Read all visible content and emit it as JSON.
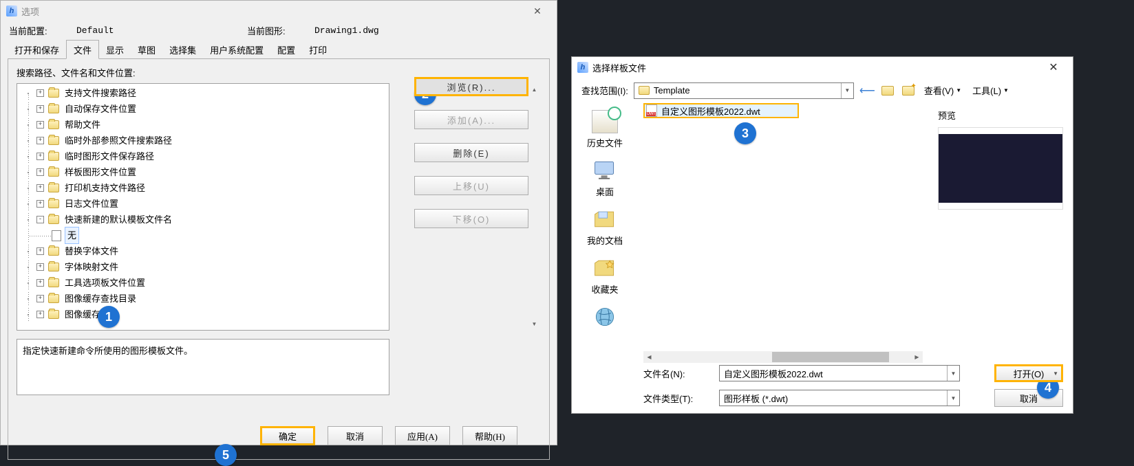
{
  "options_dialog": {
    "title": "选项",
    "info": {
      "current_config_label": "当前配置:",
      "current_config_value": "Default",
      "current_drawing_label": "当前图形:",
      "current_drawing_value": "Drawing1.dwg"
    },
    "tabs": [
      {
        "label": "打开和保存"
      },
      {
        "label": "文件",
        "active": true
      },
      {
        "label": "显示"
      },
      {
        "label": "草图"
      },
      {
        "label": "选择集"
      },
      {
        "label": "用户系统配置"
      },
      {
        "label": "配置"
      },
      {
        "label": "打印"
      }
    ],
    "group_label": "搜索路径、文件名和文件位置:",
    "tree": [
      {
        "kind": "folder",
        "exp": "+",
        "label": "支持文件搜索路径"
      },
      {
        "kind": "folder",
        "exp": "+",
        "label": "自动保存文件位置"
      },
      {
        "kind": "folder",
        "exp": "+",
        "label": "帮助文件"
      },
      {
        "kind": "folder",
        "exp": "+",
        "label": "临时外部参照文件搜索路径"
      },
      {
        "kind": "folder",
        "exp": "+",
        "label": "临时图形文件保存路径"
      },
      {
        "kind": "folder",
        "exp": "+",
        "label": "样板图形文件位置"
      },
      {
        "kind": "folder",
        "exp": "+",
        "label": "打印机支持文件路径"
      },
      {
        "kind": "folder",
        "exp": "+",
        "label": "日志文件位置"
      },
      {
        "kind": "folder",
        "exp": "-",
        "label": "快速新建的默认模板文件名",
        "children": [
          {
            "kind": "file",
            "label": "无",
            "selected": true
          }
        ]
      },
      {
        "kind": "folder",
        "exp": "+",
        "label": "替换字体文件"
      },
      {
        "kind": "folder",
        "exp": "+",
        "label": "字体映射文件"
      },
      {
        "kind": "folder",
        "exp": "+",
        "label": "工具选项板文件位置"
      },
      {
        "kind": "folder",
        "exp": "+",
        "label": "图像缓存查找目录"
      },
      {
        "kind": "folder",
        "exp": "+",
        "label": "图像缓存目录"
      }
    ],
    "side_buttons": {
      "browse": "浏览(R)...",
      "add": "添加(A)...",
      "delete": "删除(E)",
      "move_up": "上移(U)",
      "move_down": "下移(O)"
    },
    "description": "指定快速新建命令所使用的图形模板文件。",
    "bottom": {
      "ok": "确定",
      "cancel": "取消",
      "apply": "应用(A)",
      "help": "帮助(H)"
    }
  },
  "file_dialog": {
    "title": "选择样板文件",
    "look_in_label": "查找范围(I):",
    "look_in_value": "Template",
    "view_btn": "查看(V)",
    "tools_btn": "工具(L)",
    "places": [
      {
        "id": "history",
        "label": "历史文件"
      },
      {
        "id": "desktop",
        "label": "桌面"
      },
      {
        "id": "docs",
        "label": "我的文档"
      },
      {
        "id": "fav",
        "label": "收藏夹"
      },
      {
        "id": "ftp",
        "label": ""
      }
    ],
    "file_item": "自定义图形模板2022.dwt",
    "preview_label": "预览",
    "filename_label": "文件名(N):",
    "filename_value": "自定义图形模板2022.dwt",
    "filetype_label": "文件类型(T):",
    "filetype_value": "图形样板 (*.dwt)",
    "open_btn": "打开(O)",
    "cancel_btn": "取消"
  },
  "step_badges": {
    "1": "1",
    "2": "2",
    "3": "3",
    "4": "4",
    "5": "5"
  }
}
